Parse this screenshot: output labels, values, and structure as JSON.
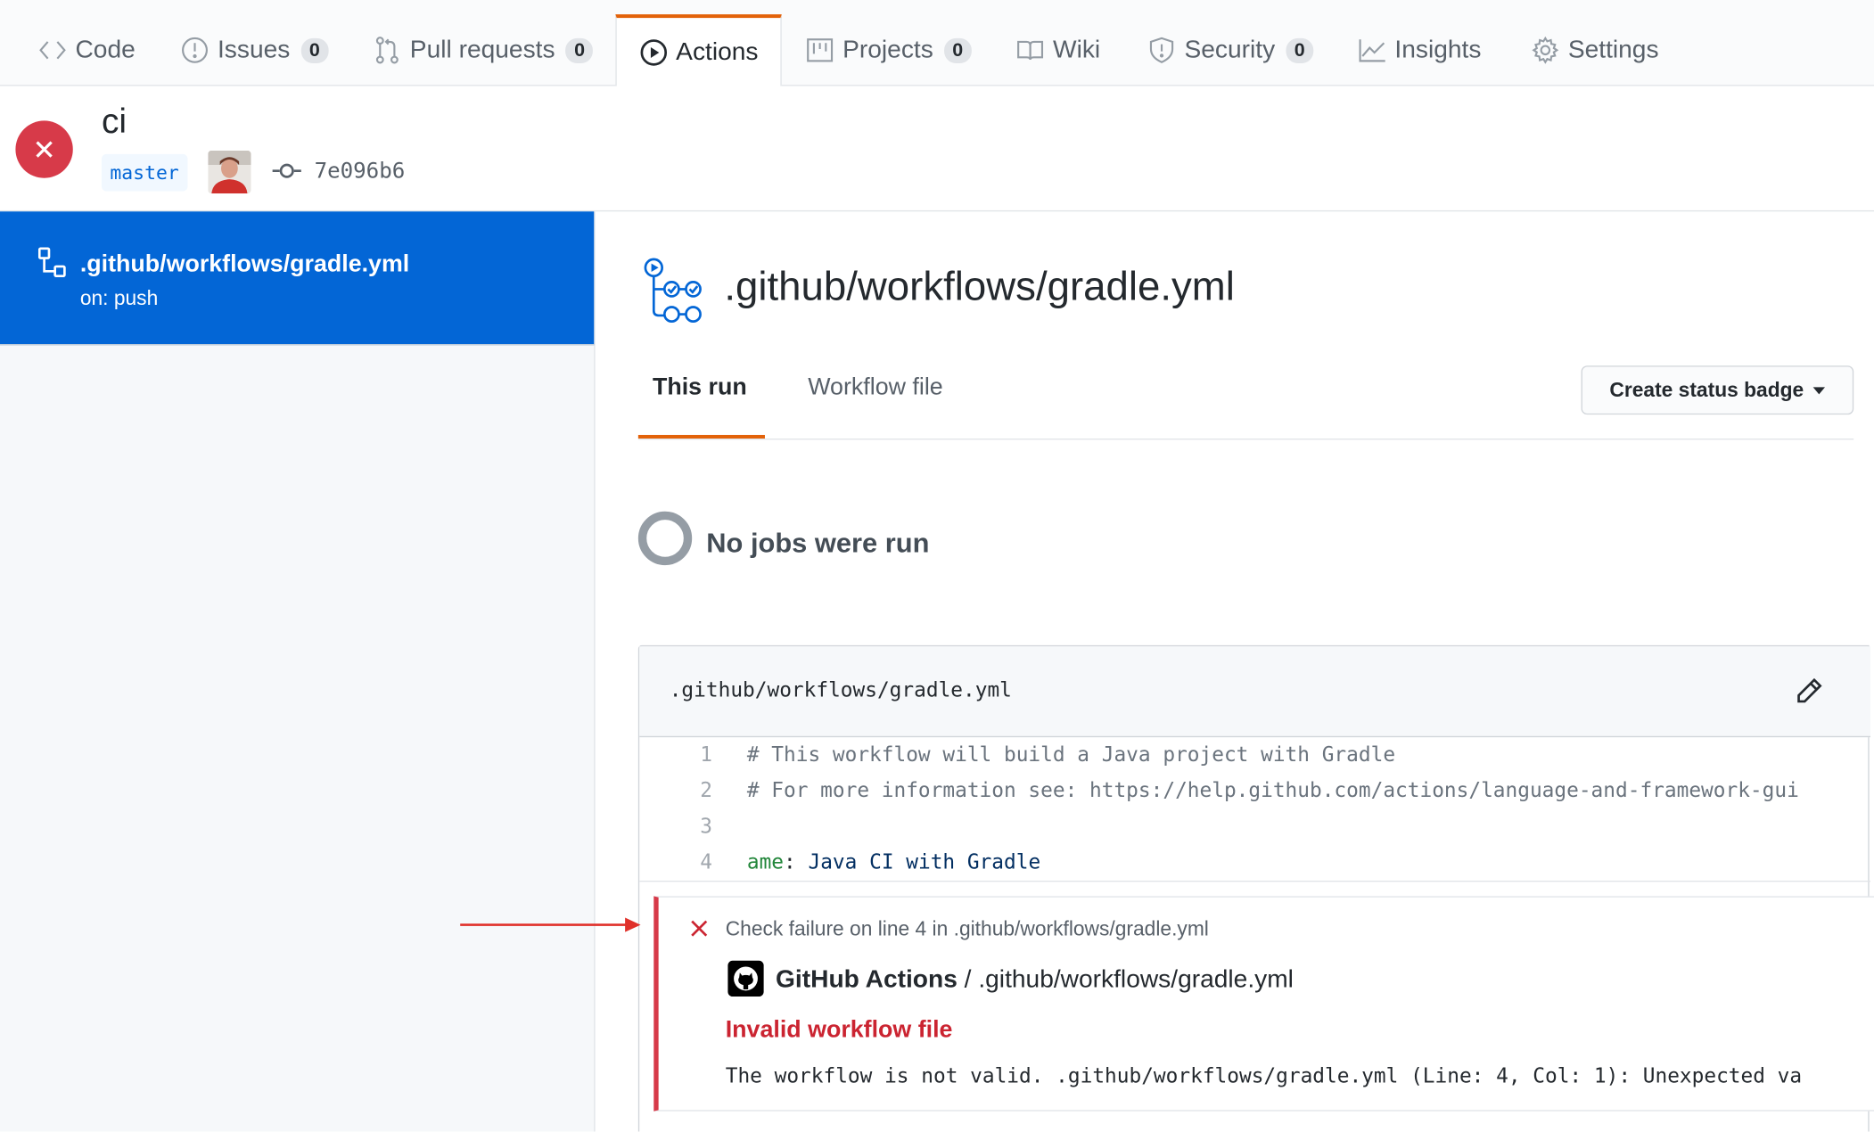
{
  "nav": {
    "tabs": [
      {
        "label": "Code",
        "icon": "code-icon"
      },
      {
        "label": "Issues",
        "icon": "issue-icon",
        "count": "0"
      },
      {
        "label": "Pull requests",
        "icon": "pull-request-icon",
        "count": "0"
      },
      {
        "label": "Actions",
        "icon": "play-icon",
        "selected": true
      },
      {
        "label": "Projects",
        "icon": "project-icon",
        "count": "0"
      },
      {
        "label": "Wiki",
        "icon": "book-icon"
      },
      {
        "label": "Security",
        "icon": "shield-icon",
        "count": "0"
      },
      {
        "label": "Insights",
        "icon": "graph-icon"
      },
      {
        "label": "Settings",
        "icon": "gear-icon"
      }
    ]
  },
  "run": {
    "status": "failure",
    "title": "ci",
    "branch": "master",
    "commit_sha": "7e096b6"
  },
  "sidebar": {
    "workflow_path": ".github/workflows/gradle.yml",
    "trigger": "on: push"
  },
  "main": {
    "title": ".github/workflows/gradle.yml",
    "tabs": {
      "this_run": "This run",
      "workflow_file": "Workflow file"
    },
    "status_badge_button": "Create status badge",
    "no_jobs": "No jobs were run"
  },
  "file": {
    "name": ".github/workflows/gradle.yml",
    "lines": [
      {
        "num": "1",
        "text": "# This workflow will build a Java project with Gradle"
      },
      {
        "num": "2",
        "text": "# For more information see: https://help.github.com/actions/language-and-framework-gui"
      },
      {
        "num": "3",
        "text": ""
      },
      {
        "num": "4",
        "key": "ame",
        "sep": ": ",
        "value": "Java CI with Gradle"
      }
    ]
  },
  "annotation": {
    "title": "Check failure on line 4 in .github/workflows/gradle.yml",
    "source_app": "GitHub Actions",
    "source_sep": " / ",
    "source_file": ".github/workflows/gradle.yml",
    "error_title": "Invalid workflow file",
    "message": "The workflow is not valid. .github/workflows/gradle.yml (Line: 4, Col: 1): Unexpected va"
  },
  "colors": {
    "accent_orange": "#e36209",
    "selected_blue": "#0366d6",
    "failure_red": "#d73a49",
    "arrow_red": "#e0302a"
  }
}
